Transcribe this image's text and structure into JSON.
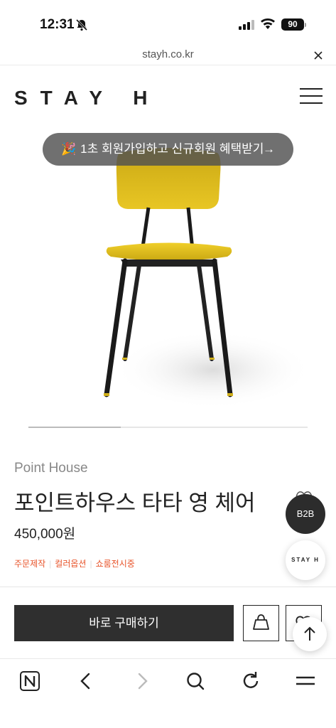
{
  "status_bar": {
    "time": "12:31",
    "battery": "90"
  },
  "browser": {
    "url": "stayh.co.kr"
  },
  "header": {
    "logo": "STAY H"
  },
  "promo": {
    "emoji": "🎉",
    "text": "1초 회원가입하고 신규회원 혜택받기",
    "arrow": "→"
  },
  "product": {
    "brand": "Point House",
    "title": "포인트하우스 타타 영 체어",
    "price": "450,000원",
    "tags": [
      "주문제작",
      "컬러옵션",
      "쇼룸전시중"
    ],
    "chair_color": "#e5c21a"
  },
  "fabs": {
    "b2b": "B2B",
    "stayh": "STAY H"
  },
  "actions": {
    "buy_label": "바로 구매하기"
  },
  "colors": {
    "accent_tag": "#e8542a",
    "dark": "#2f2f2f"
  }
}
